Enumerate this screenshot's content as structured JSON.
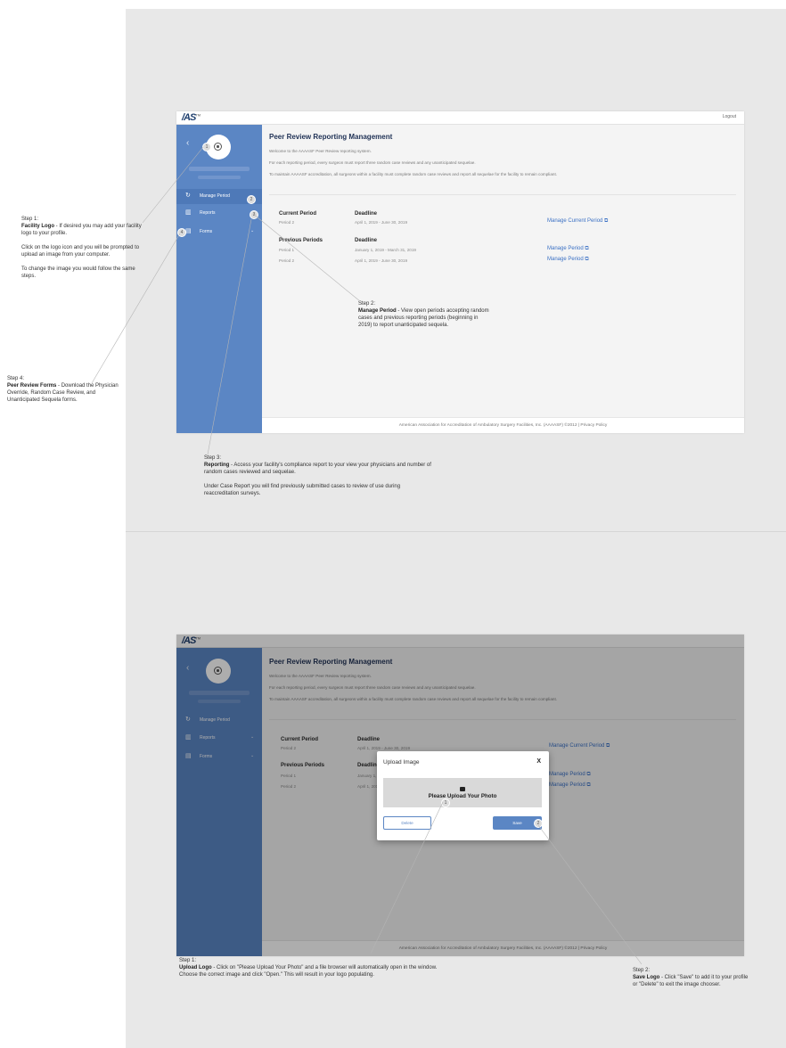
{
  "common": {
    "logo_text": "/AS",
    "logo_tm": "TM",
    "logout": "Logout",
    "back_icon": "‹",
    "page_title": "Peer Review Reporting Management",
    "intro": [
      "Welcome to the AAAASF Peer Review reporting system.",
      "For each reporting period, every surgeon must report three random case reviews and any unanticipated sequelae.",
      "To maintain AAAASF accreditation, all surgeons within a facility must complete random case reviews and report all sequelae for the facility to remain compliant."
    ],
    "nav": {
      "manage_period": "Manage Period",
      "reports": "Reports",
      "forms": "Forms",
      "chevron": "⌄"
    },
    "current_period_label": "Current Period",
    "deadline_label": "Deadline",
    "previous_periods_label": "Previous Periods",
    "current_period_name": "Period 2",
    "current_period_dates": "April 1, 2019 - June 30, 2019",
    "manage_current_period": "Manage Current Period",
    "previous": [
      {
        "name": "Period 1",
        "dates": "January 1, 2019 - March 31, 2019",
        "link": "Manage Period"
      },
      {
        "name": "Period 2",
        "dates": "April 1, 2019 - June 30, 2019",
        "link": "Manage Period"
      }
    ],
    "footer": "American Association for Accreditation of Ambulatory Surgery Facilities, Inc. (AAAASF) ©2012   |   Privacy Policy",
    "ext_icon": "⧉"
  },
  "top_badges": [
    "1",
    "2",
    "3",
    "4"
  ],
  "top_notes": {
    "step1_head": "Step 1:",
    "step1_bold": "Facility Logo",
    "step1_rest": " - If desired you may add your facility logo to your profile.",
    "step1_p2": "Click on the logo icon and you will be prompted to upload an image from your computer.",
    "step1_p3": "To change the image you would follow the same steps.",
    "step4_head": "Step 4:",
    "step4_bold": "Peer Review Forms",
    "step4_rest": " - Download the Physician Override, Random Case Review, and Unanticipated Sequela forms.",
    "step2_head": "Step 2:",
    "step2_bold": "Manage Period",
    "step2_rest": " - View open periods accepting random cases and previous reporting periods (beginning in 2019) to report unanticipated sequela.",
    "step3_head": "Step 3:",
    "step3_bold": "Reporting",
    "step3_rest": " - Access your facility's compliance report to your view your physicians and number of random cases reviewed and sequelae.",
    "step3_p2": "Under Case Report you will find previously submitted cases to review of use during reaccreditation surveys."
  },
  "modal": {
    "title": "Upload Image",
    "close": "X",
    "upload_text": "Please Upload Your Photo",
    "delete": "Delete",
    "save": "Save",
    "badge1": "1",
    "badge2": "2"
  },
  "bottom_notes": {
    "step1_head": "Step 1:",
    "step1_bold": "Upload Logo",
    "step1_rest": " - Click on \"Please Upload Your Photo\" and a file browser will automatically open in the window. Choose the correct image and click \"Open.\" This will result in your logo populating.",
    "step2_head": "Step 2:",
    "step2_bold": "Save Logo",
    "step2_rest": " - Click \"Save\" to add it to your profile or \"Delete\" to exit the image chooser."
  }
}
